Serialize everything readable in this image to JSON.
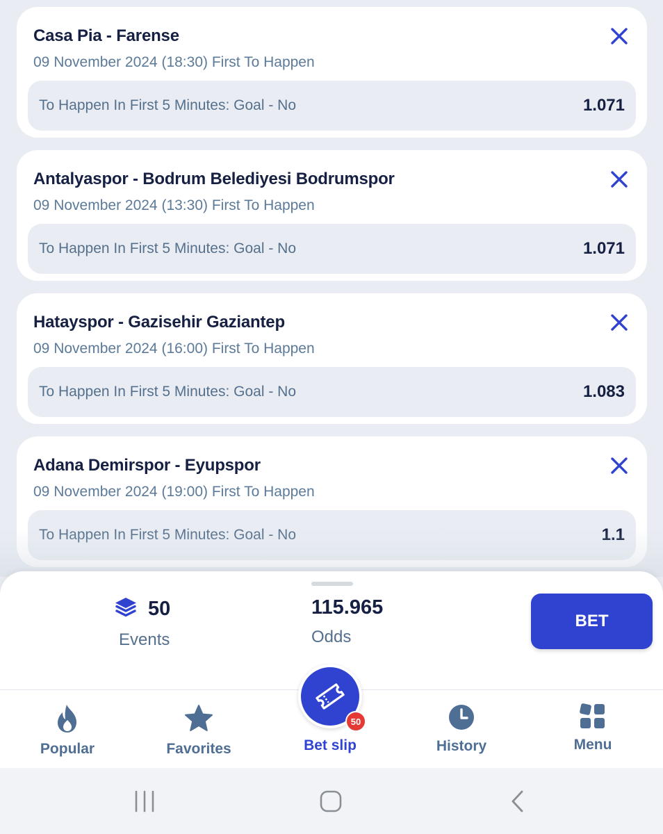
{
  "bets": [
    {
      "match": "Casa Pia - Farense",
      "info": "09 November 2024 (18:30) First To Happen",
      "selection": "To Happen In First 5 Minutes: Goal - No",
      "odds": "1.071"
    },
    {
      "match": "Antalyaspor - Bodrum Belediyesi Bodrumspor",
      "info": "09 November 2024 (13:30) First To Happen",
      "selection": "To Happen In First 5 Minutes: Goal - No",
      "odds": "1.071"
    },
    {
      "match": "Hatayspor - Gazisehir Gaziantep",
      "info": "09 November 2024 (16:00) First To Happen",
      "selection": "To Happen In First 5 Minutes: Goal - No",
      "odds": "1.083"
    },
    {
      "match": "Adana Demirspor - Eyupspor",
      "info": "09 November 2024 (19:00) First To Happen",
      "selection": "To Happen In First 5 Minutes: Goal - No",
      "odds": "1.1"
    }
  ],
  "summary": {
    "events_count": "50",
    "events_label": "Events",
    "total_odds": "115.965",
    "odds_label": "Odds",
    "bet_button": "BET"
  },
  "nav": {
    "popular": "Popular",
    "favorites": "Favorites",
    "betslip": "Bet slip",
    "betslip_badge": "50",
    "history": "History",
    "menu": "Menu"
  },
  "colors": {
    "accent": "#2f43d0",
    "nav_icon": "#4f6e94",
    "title": "#152042",
    "badge": "#e53935"
  }
}
